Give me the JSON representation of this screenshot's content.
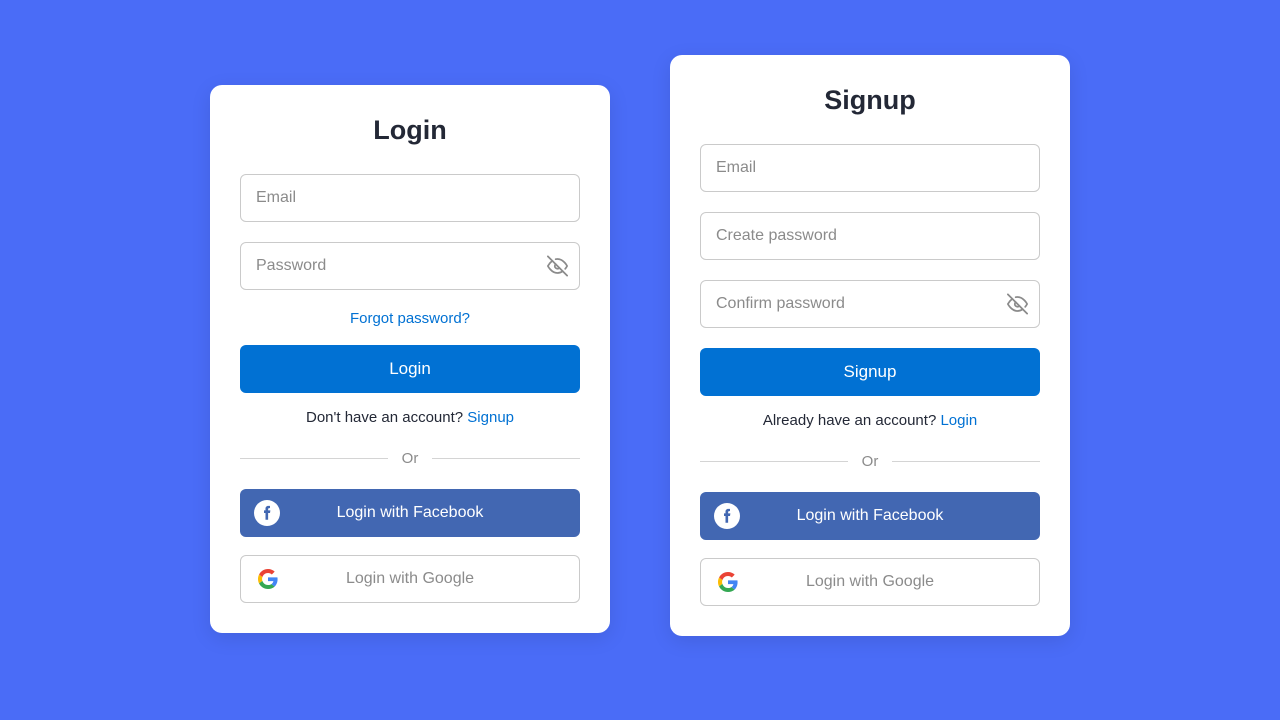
{
  "login": {
    "title": "Login",
    "email_placeholder": "Email",
    "password_placeholder": "Password",
    "forgot": "Forgot password?",
    "submit": "Login",
    "no_account_text": "Don't have an account? ",
    "no_account_link": "Signup",
    "or": "Or",
    "facebook": "Login with Facebook",
    "google": "Login with Google"
  },
  "signup": {
    "title": "Signup",
    "email_placeholder": "Email",
    "create_password_placeholder": "Create password",
    "confirm_password_placeholder": "Confirm password",
    "submit": "Signup",
    "have_account_text": "Already have an account? ",
    "have_account_link": "Login",
    "or": "Or",
    "facebook": "Login with Facebook",
    "google": "Login with Google"
  }
}
